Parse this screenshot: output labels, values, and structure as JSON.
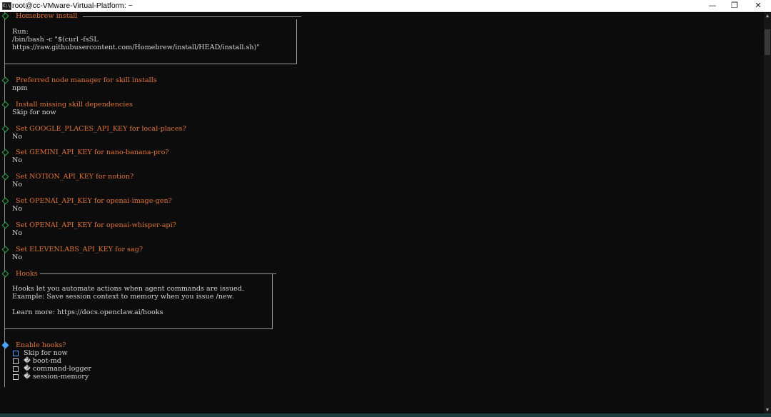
{
  "window": {
    "title": "root@cc-VMware-Virtual-Platform: ~",
    "icon_glyph": "C:\\",
    "minimize_glyph": "—",
    "maximize_glyph": "❐",
    "close_glyph": "✕"
  },
  "homebrew_box": {
    "title": "Homebrew install",
    "lines": [
      "Run:",
      "/bin/bash -c \"$(curl -fsSL",
      "https://raw.githubusercontent.com/Homebrew/install/HEAD/install.sh)\""
    ]
  },
  "prompts": [
    {
      "question": "Preferred node manager for skill installs",
      "answer": "npm"
    },
    {
      "question": "Install missing skill dependencies",
      "answer": "Skip for now"
    },
    {
      "question": "Set GOOGLE_PLACES_API_KEY for local-places?",
      "answer": "No"
    },
    {
      "question": "Set GEMINI_API_KEY for nano-banana-pro?",
      "answer": "No"
    },
    {
      "question": "Set NOTION_API_KEY for notion?",
      "answer": "No"
    },
    {
      "question": "Set OPENAI_API_KEY for openai-image-gen?",
      "answer": "No"
    },
    {
      "question": "Set OPENAI_API_KEY for openai-whisper-api?",
      "answer": "No"
    },
    {
      "question": "Set ELEVENLABS_API_KEY for sag?",
      "answer": "No"
    }
  ],
  "hooks_box": {
    "title": "Hooks",
    "lines": [
      "Hooks let you automate actions when agent commands are issued.",
      "Example: Save session context to memory when you issue /new.",
      "",
      "Learn more: https://docs.openclaw.ai/hooks"
    ]
  },
  "enable_hooks": {
    "question": "Enable hooks?",
    "options": [
      "Skip for now",
      "� boot-md",
      "� command-logger",
      "� session-memory"
    ]
  },
  "colors": {
    "prompt": "#e0733a",
    "answer": "#d4d4d4",
    "step_marker": "#2fa84f",
    "active_marker": "#4aa3ff",
    "background": "#0c0c0c"
  },
  "scrollbar": {
    "up_glyph": "▲",
    "down_glyph": "▼"
  }
}
